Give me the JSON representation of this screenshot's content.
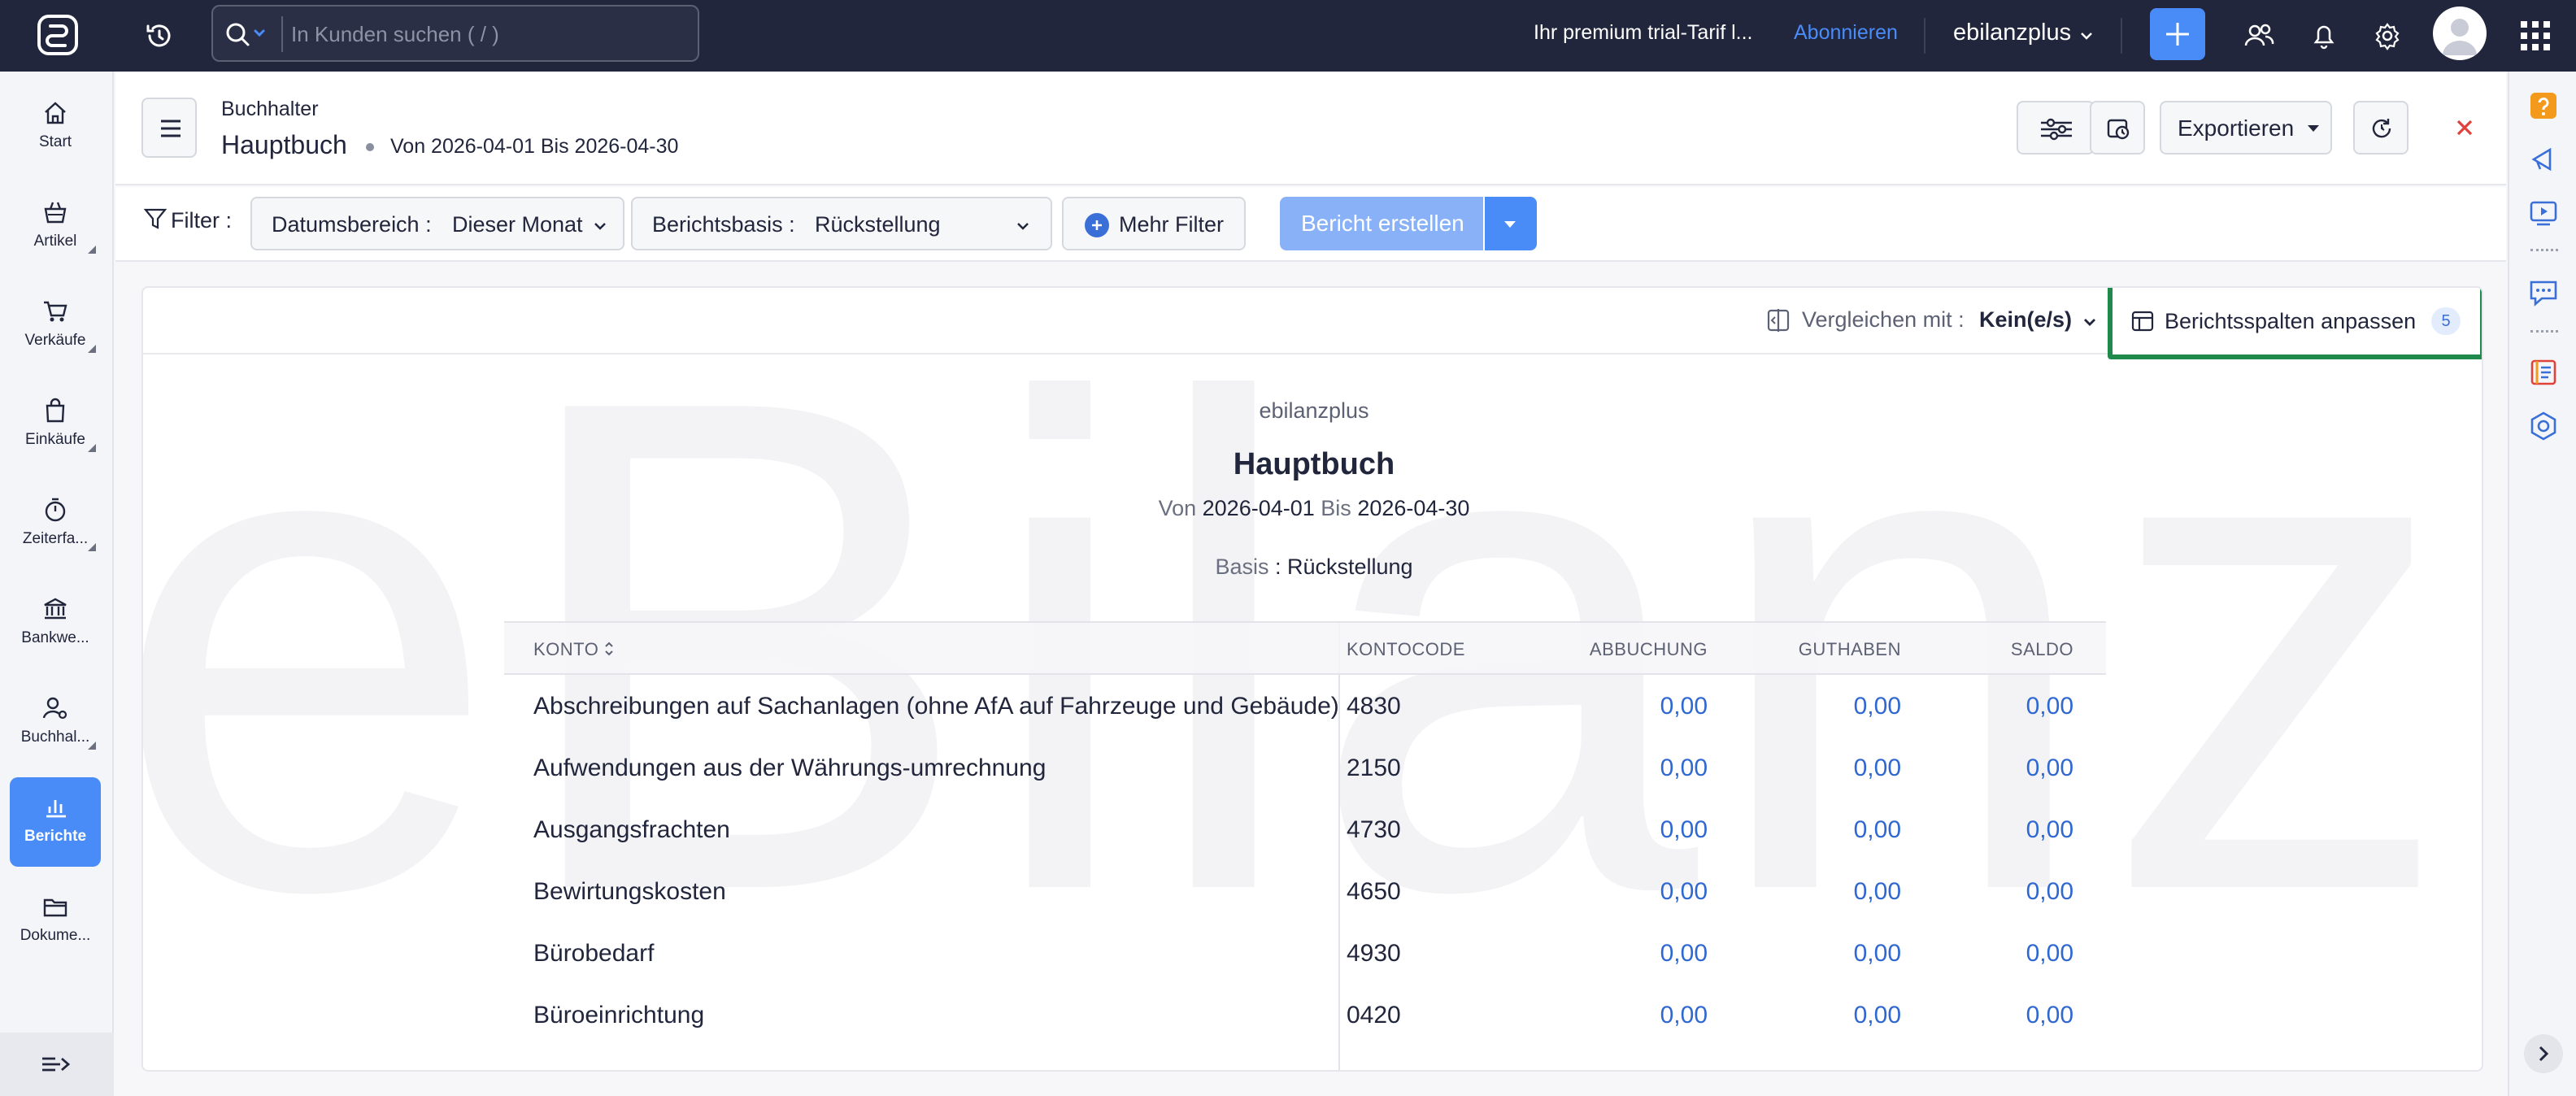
{
  "topbar": {
    "search_placeholder": "In Kunden suchen ( / )",
    "trial_text": "Ihr premium trial-Tarif l...",
    "subscribe_label": "Abonnieren",
    "org_name": "ebilanzplus"
  },
  "sidebar": {
    "items": [
      {
        "label": "Start",
        "icon": "home-icon"
      },
      {
        "label": "Artikel",
        "icon": "basket-icon"
      },
      {
        "label": "Verkäufe",
        "icon": "cart-icon"
      },
      {
        "label": "Einkäufe",
        "icon": "shopping-bag-icon"
      },
      {
        "label": "Zeiterfa...",
        "icon": "stopwatch-icon"
      },
      {
        "label": "Bankwe...",
        "icon": "bank-icon"
      },
      {
        "label": "Buchhal...",
        "icon": "accountant-icon"
      },
      {
        "label": "Berichte",
        "icon": "bar-chart-icon",
        "active": true
      },
      {
        "label": "Dokume...",
        "icon": "folder-icon"
      }
    ]
  },
  "header": {
    "breadcrumb": "Buchhalter",
    "title": "Hauptbuch",
    "period": "Von 2026-04-01 Bis 2026-04-30",
    "export_label": "Exportieren"
  },
  "filters": {
    "filter_label": "Filter :",
    "date_range_key": "Datumsbereich :",
    "date_range_value": "Dieser Monat",
    "basis_key": "Berichtsbasis :",
    "basis_value": "Rückstellung",
    "more_filter_label": "Mehr Filter",
    "create_report_label": "Bericht erstellen"
  },
  "report": {
    "compare_label": "Vergleichen mit :",
    "compare_value": "Kein(e/s)",
    "customize_label": "Berichtsspalten anpassen",
    "customize_count": "5",
    "company": "ebilanzplus",
    "title": "Hauptbuch",
    "period_from_label": "Von",
    "period_from": "2026-04-01",
    "period_to_label": "Bis",
    "period_to": "2026-04-30",
    "basis_label": "Basis",
    "basis_value": "Rückstellung",
    "watermark": "eBilanz+",
    "columns": [
      "KONTO",
      "KONTOCODE",
      "ABBUCHUNG",
      "GUTHABEN",
      "SALDO"
    ],
    "rows": [
      {
        "konto": "Abschreibungen auf Sachanlagen (ohne AfA auf Fahrzeuge und Gebäude)",
        "code": "4830",
        "abbuchung": "0,00",
        "guthaben": "0,00",
        "saldo": "0,00"
      },
      {
        "konto": "Aufwendungen aus der Währungs-umrechnung",
        "code": "2150",
        "abbuchung": "0,00",
        "guthaben": "0,00",
        "saldo": "0,00"
      },
      {
        "konto": "Ausgangsfrachten",
        "code": "4730",
        "abbuchung": "0,00",
        "guthaben": "0,00",
        "saldo": "0,00"
      },
      {
        "konto": "Bewirtungskosten",
        "code": "4650",
        "abbuchung": "0,00",
        "guthaben": "0,00",
        "saldo": "0,00"
      },
      {
        "konto": "Bürobedarf",
        "code": "4930",
        "abbuchung": "0,00",
        "guthaben": "0,00",
        "saldo": "0,00"
      },
      {
        "konto": "Büroeinrichtung",
        "code": "0420",
        "abbuchung": "0,00",
        "guthaben": "0,00",
        "saldo": "0,00"
      }
    ]
  },
  "colors": {
    "topbar_bg": "#21263c",
    "accent": "#4a8cf7",
    "link": "#2f68d1",
    "highlight_border": "#1f8a4c",
    "close": "#e0413a"
  }
}
